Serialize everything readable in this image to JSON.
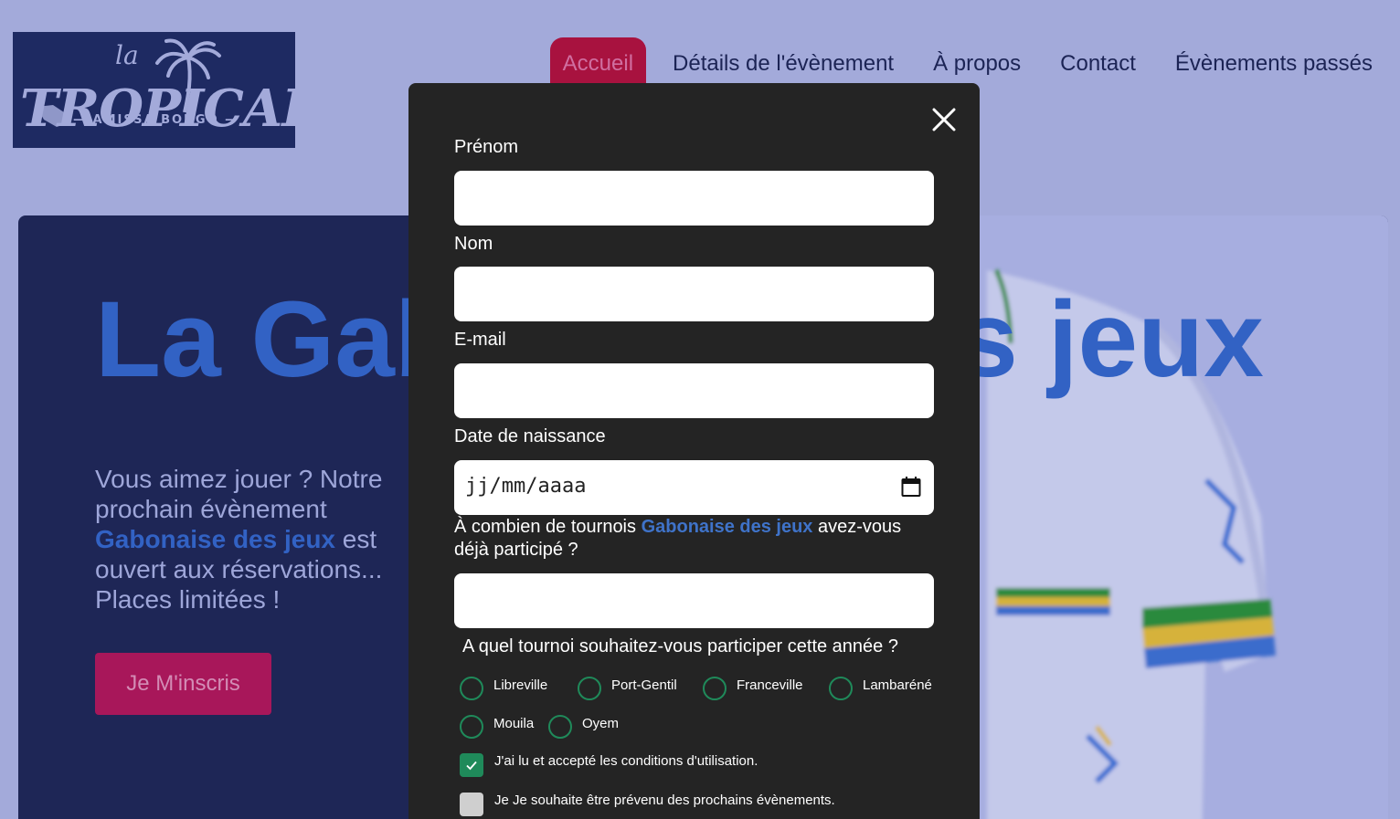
{
  "logo": {
    "small": "la",
    "word": "TROPICALE",
    "subtitle": "— AMISSA BONGO —"
  },
  "nav": {
    "items": [
      {
        "label": "Accueil",
        "active": true
      },
      {
        "label": "Détails de l'évènement"
      },
      {
        "label": "À propos"
      },
      {
        "label": "Contact"
      },
      {
        "label": "Évènements passés"
      }
    ]
  },
  "hero": {
    "title": "La Gabonaise des jeux",
    "text_1": "Vous aimez jouer ? Notre prochain",
    "text_2": "évènement",
    "text_highlight": "Gabonaise des jeux",
    "text_3": "est ouvert aux réservations... Places limitées !",
    "button": "Je M'inscris"
  },
  "modal": {
    "first_name_label": "Prénom",
    "first_name_value": "",
    "last_name_label": "Nom",
    "last_name_value": "",
    "email_label": "E-mail",
    "email_value": "",
    "birthdate_label": "Date de naissance",
    "birthdate_placeholder": "jj/mm/aaaa",
    "tournaments_question_pre": "À combien de tournois",
    "tournaments_question_highlight": "Gabonaise des jeux",
    "tournaments_question_post": "avez-vous déjà participé ?",
    "tournaments_value": "",
    "location_question": "A quel tournoi souhaitez-vous participer cette année ?",
    "locations": [
      "Libreville",
      "Port-Gentil",
      "Franceville",
      "Lambaréné",
      "Mouila",
      "Oyem"
    ],
    "terms_label": "J'ai lu et accepté les conditions d'utilisation.",
    "terms_checked": true,
    "newsletter_label": "Je Je souhaite être prévenu des prochains évènements.",
    "newsletter_checked": false
  },
  "colors": {
    "page_bg": "#a3aada",
    "accent": "#a8123f",
    "modal_bg": "#242424",
    "radio_green": "#1f8a5a",
    "title_blue": "#3262c4"
  }
}
